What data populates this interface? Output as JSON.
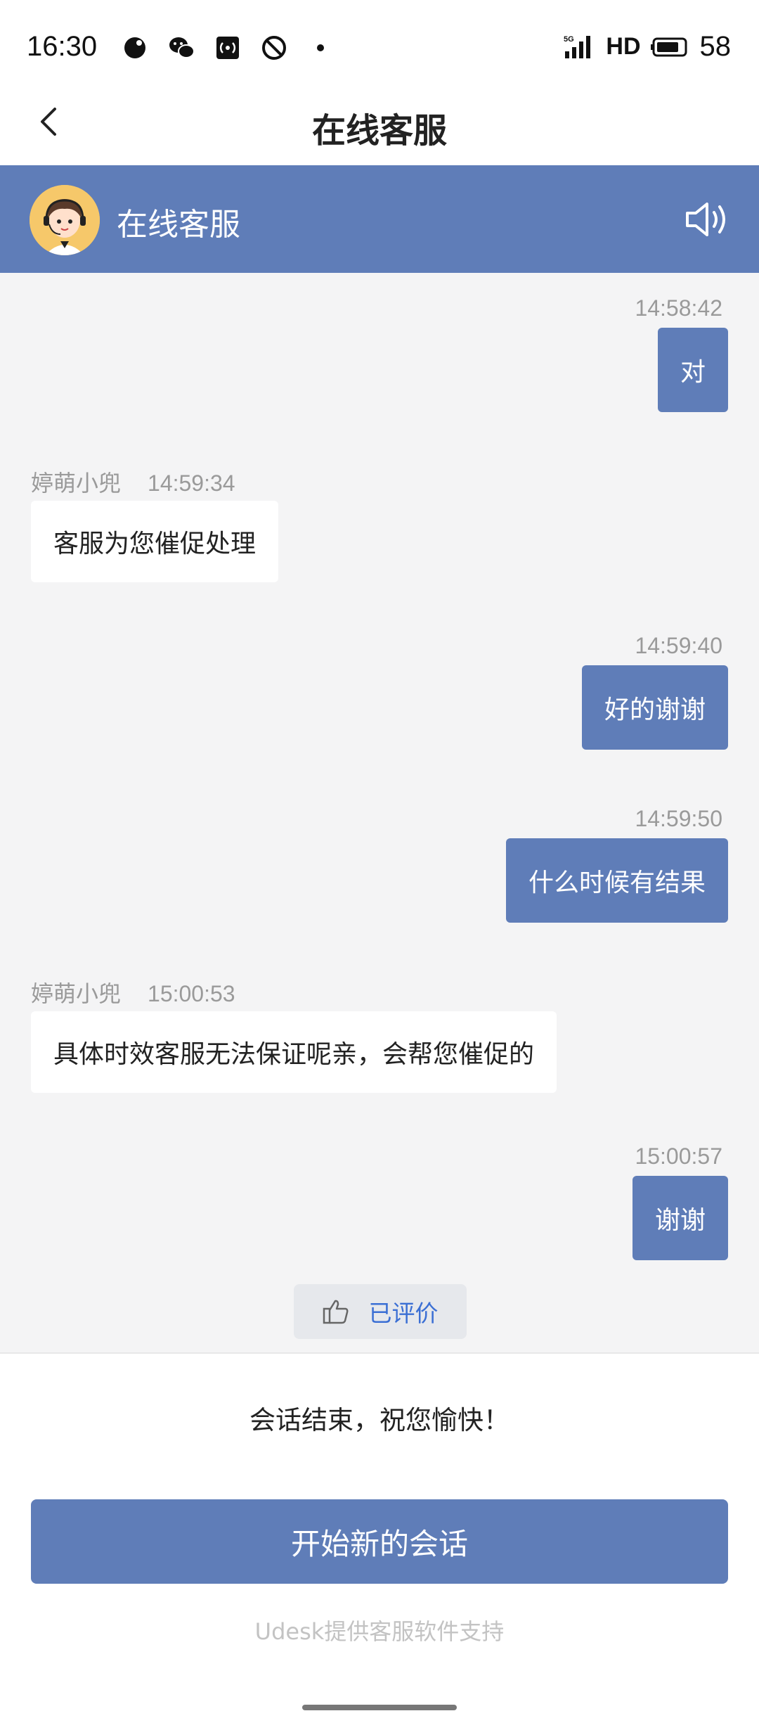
{
  "status_bar": {
    "time": "16:30",
    "network": "5G",
    "hd": "HD",
    "battery": "58"
  },
  "nav": {
    "title": "在线客服"
  },
  "agent_header": {
    "name": "在线客服"
  },
  "messages": [
    {
      "dir": "out",
      "time": "14:58:42",
      "text": "对"
    },
    {
      "dir": "in",
      "sender": "婷萌小兜",
      "time": "14:59:34",
      "text": "客服为您催促处理"
    },
    {
      "dir": "out",
      "time": "14:59:40",
      "text": "好的谢谢"
    },
    {
      "dir": "out",
      "time": "14:59:50",
      "text": "什么时候有结果"
    },
    {
      "dir": "in",
      "sender": "婷萌小兜",
      "time": "15:00:53",
      "text": "具体时效客服无法保证呢亲，会帮您催促的"
    },
    {
      "dir": "out",
      "time": "15:00:57",
      "text": "谢谢"
    }
  ],
  "rating": {
    "label": "已评价"
  },
  "footer": {
    "end_text": "会话结束，祝您愉快！",
    "new_chat_label": "开始新的会话",
    "powered_by": "Udesk提供客服软件支持"
  },
  "colors": {
    "accent": "#5f7db8",
    "background": "#f4f4f5",
    "link": "#3b6fd4"
  }
}
